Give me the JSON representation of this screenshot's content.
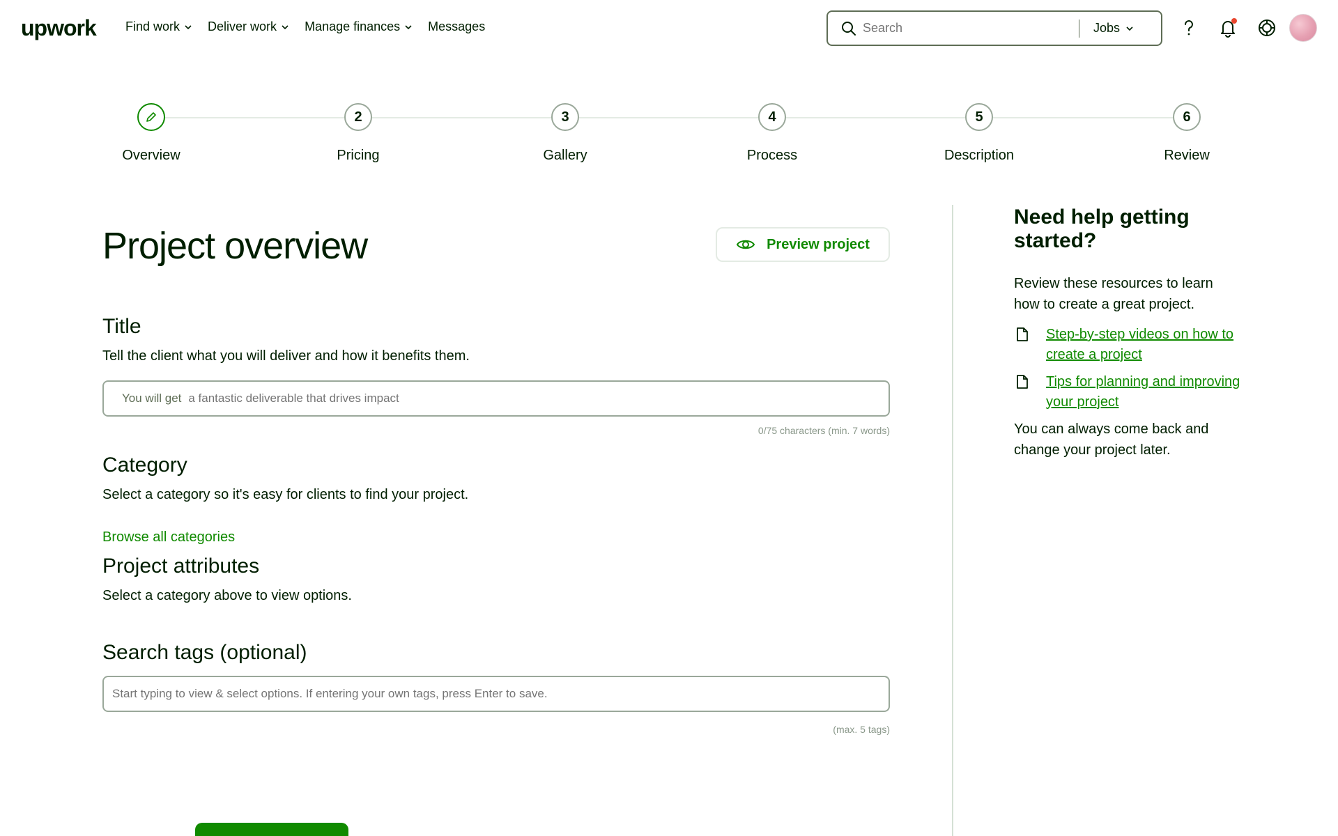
{
  "header": {
    "logo": "upwork",
    "nav": [
      {
        "label": "Find work"
      },
      {
        "label": "Deliver work"
      },
      {
        "label": "Manage finances"
      },
      {
        "label": "Messages"
      }
    ],
    "search": {
      "placeholder": "Search",
      "scope": "Jobs"
    },
    "icons": [
      "help-icon",
      "bell-icon",
      "apps-icon"
    ]
  },
  "stepper": {
    "steps": [
      {
        "number": "",
        "label": "Overview",
        "active": true
      },
      {
        "number": "2",
        "label": "Pricing"
      },
      {
        "number": "3",
        "label": "Gallery"
      },
      {
        "number": "4",
        "label": "Process"
      },
      {
        "number": "5",
        "label": "Description"
      },
      {
        "number": "6",
        "label": "Review"
      }
    ]
  },
  "main": {
    "title": "Project overview",
    "preview_label": "Preview project",
    "title_section": {
      "heading": "Title",
      "description": "Tell the client what you will deliver and how it benefits them.",
      "prefix": "You will get",
      "placeholder": "a fantastic deliverable that drives impact",
      "counter": "0/75 characters (min. 7 words)"
    },
    "category_section": {
      "heading": "Category",
      "description": "Select a category so it's easy for clients to find your project.",
      "browse_link": "Browse all categories"
    },
    "attributes_section": {
      "heading": "Project attributes",
      "description": "Select a category above to view options."
    },
    "tags_section": {
      "heading": "Search tags (optional)",
      "placeholder": "Start typing to view & select options. If entering your own tags, press Enter to save.",
      "counter": "(max. 5 tags)"
    }
  },
  "sidebar": {
    "title": "Need help getting started?",
    "intro": "Review these resources to learn how to create a great project.",
    "links": [
      {
        "label": "Step-by-step videos on how to create a project"
      },
      {
        "label": "Tips for planning and improving your project"
      }
    ],
    "outro": "You can always come back and change your project later."
  },
  "colors": {
    "accent": "#108a00",
    "text": "#001e00",
    "muted": "#5e6d55"
  }
}
